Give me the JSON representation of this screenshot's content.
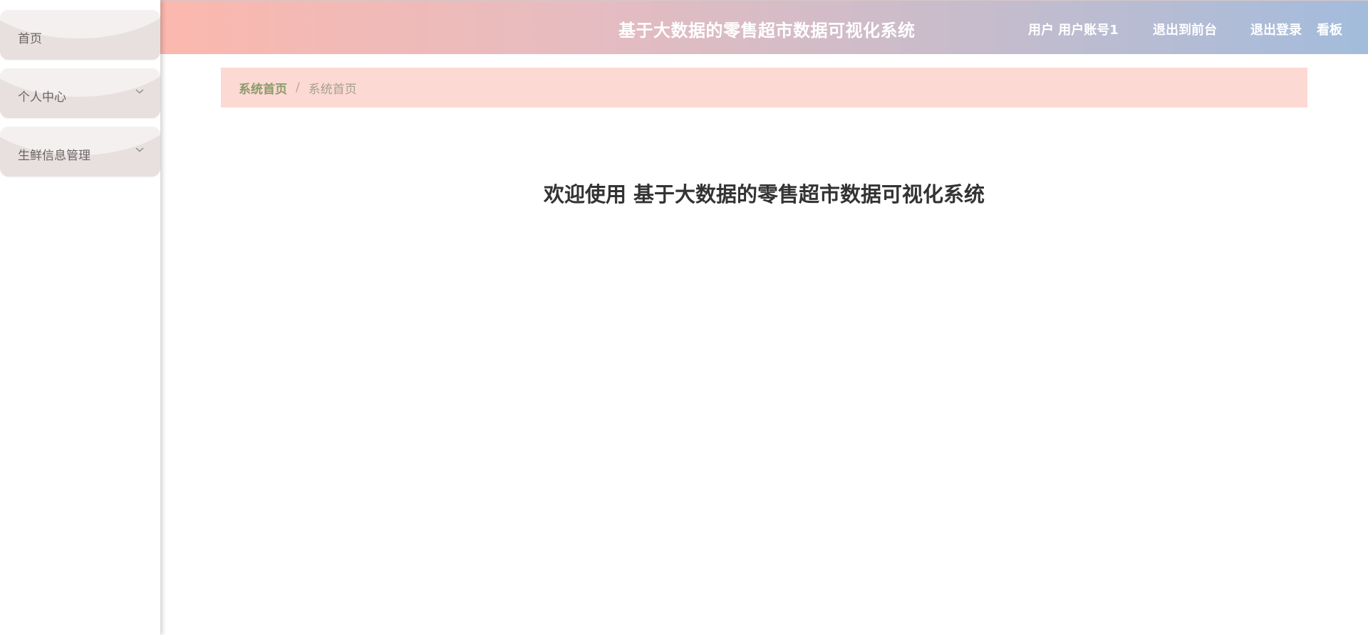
{
  "header": {
    "title": "基于大数据的零售超市数据可视化系统",
    "user_label": "用户 用户账号1",
    "exit_front": "退出到前台",
    "logout": "退出登录",
    "dashboard": "看板"
  },
  "sidebar": {
    "items": [
      {
        "label": "首页",
        "has_submenu": false
      },
      {
        "label": "个人中心",
        "has_submenu": true
      },
      {
        "label": "生鲜信息管理",
        "has_submenu": true
      }
    ]
  },
  "breadcrumb": {
    "home": "系统首页",
    "separator": "/",
    "current": "系统首页"
  },
  "main": {
    "welcome": "欢迎使用 基于大数据的零售超市数据可视化系统"
  },
  "colors": {
    "header_gradient_start": "#fbb8ae",
    "header_gradient_end": "#a3bcdc",
    "breadcrumb_bg": "#fdd9d3",
    "breadcrumb_home": "#8a9b6a",
    "sidebar_item_bg": "#e8e0de"
  }
}
